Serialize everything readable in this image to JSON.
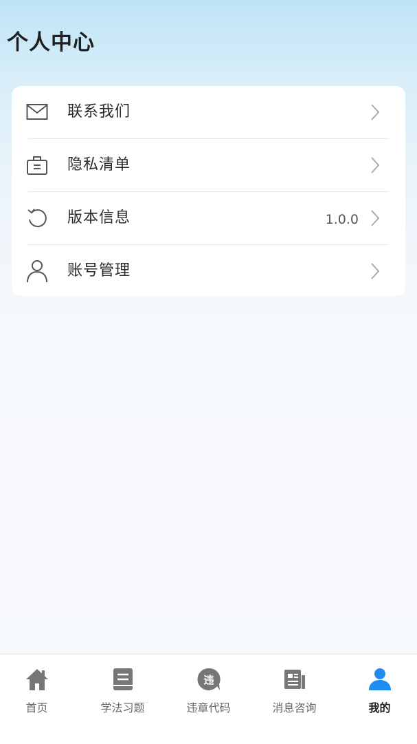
{
  "header": {
    "title": "个人中心"
  },
  "menu": {
    "items": [
      {
        "label": "联系我们",
        "icon": "mail-icon",
        "value": ""
      },
      {
        "label": "隐私清单",
        "icon": "privacy-list-icon",
        "value": ""
      },
      {
        "label": "版本信息",
        "icon": "refresh-icon",
        "value": "1.0.0"
      },
      {
        "label": "账号管理",
        "icon": "user-icon",
        "value": ""
      }
    ]
  },
  "tabbar": {
    "items": [
      {
        "label": "首页",
        "icon": "home-icon",
        "active": false
      },
      {
        "label": "学法习题",
        "icon": "book-icon",
        "active": false
      },
      {
        "label": "违章代码",
        "icon": "violation-icon",
        "active": false
      },
      {
        "label": "消息咨询",
        "icon": "news-icon",
        "active": false
      },
      {
        "label": "我的",
        "icon": "profile-icon",
        "active": true
      }
    ]
  },
  "colors": {
    "accent": "#1e8cf0",
    "inactive_icon": "#777777",
    "card_background": "#ffffff"
  }
}
